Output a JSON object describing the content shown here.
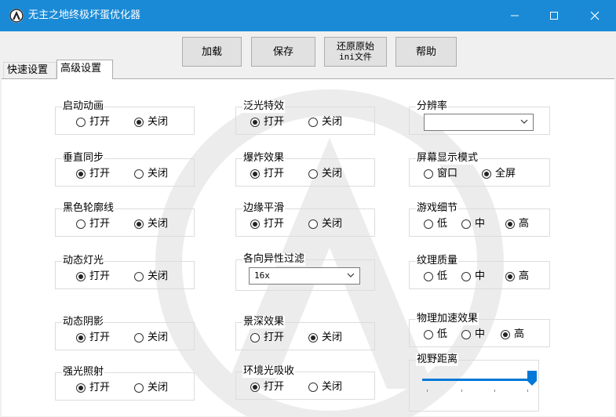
{
  "window": {
    "title": "无主之地终极坏蛋优化器",
    "accent": "#1a8ad6",
    "minimize_label": "—",
    "maximize_label": "☐",
    "close_label": "✕"
  },
  "toolbar": {
    "load": "加载",
    "save": "保存",
    "restore_line1": "还原原始",
    "restore_line2": "ini文件",
    "help": "帮助"
  },
  "tabs": {
    "quick": "快速设置",
    "advanced": "高级设置"
  },
  "settings": {
    "startup_animation": {
      "label": "启动动画",
      "on": "打开",
      "off": "关闭",
      "selected": "off"
    },
    "vsync": {
      "label": "垂直同步",
      "on": "打开",
      "off": "关闭",
      "selected": "on"
    },
    "black_outline": {
      "label": "黑色轮廓线",
      "on": "打开",
      "off": "关闭",
      "selected": "off"
    },
    "dynamic_lighting": {
      "label": "动态灯光",
      "on": "打开",
      "off": "关闭",
      "selected": "on"
    },
    "dynamic_shadows": {
      "label": "动态阴影",
      "on": "打开",
      "off": "关闭",
      "selected": "on"
    },
    "strong_light": {
      "label": "强光照射",
      "on": "打开",
      "off": "关闭",
      "selected": "on"
    },
    "bloom": {
      "label": "泛光特效",
      "on": "打开",
      "off": "关闭",
      "selected": "on"
    },
    "explosion": {
      "label": "爆炸效果",
      "on": "打开",
      "off": "关闭",
      "selected": "on"
    },
    "edge_smoothing": {
      "label": "边缘平滑",
      "on": "打开",
      "off": "关闭",
      "selected": "on"
    },
    "anisotropic": {
      "label": "各向异性过滤",
      "value": "16x"
    },
    "depth_of_field": {
      "label": "景深效果",
      "on": "打开",
      "off": "关闭",
      "selected": "off"
    },
    "ambient_occlusion": {
      "label": "环境光吸收",
      "on": "打开",
      "off": "关闭",
      "selected": "on"
    },
    "resolution": {
      "label": "分辨率",
      "value": ""
    },
    "display_mode": {
      "label": "屏幕显示模式",
      "windowed": "窗口",
      "fullscreen": "全屏",
      "selected": "fullscreen"
    },
    "game_detail": {
      "label": "游戏细节",
      "low": "低",
      "mid": "中",
      "high": "高",
      "selected": "high"
    },
    "texture_quality": {
      "label": "纹理质量",
      "low": "低",
      "mid": "中",
      "high": "高",
      "selected": "high"
    },
    "physx": {
      "label": "物理加速效果",
      "low": "低",
      "mid": "中",
      "high": "高",
      "selected": "high"
    },
    "fov": {
      "label": "视野距离",
      "level": 1.0
    }
  }
}
